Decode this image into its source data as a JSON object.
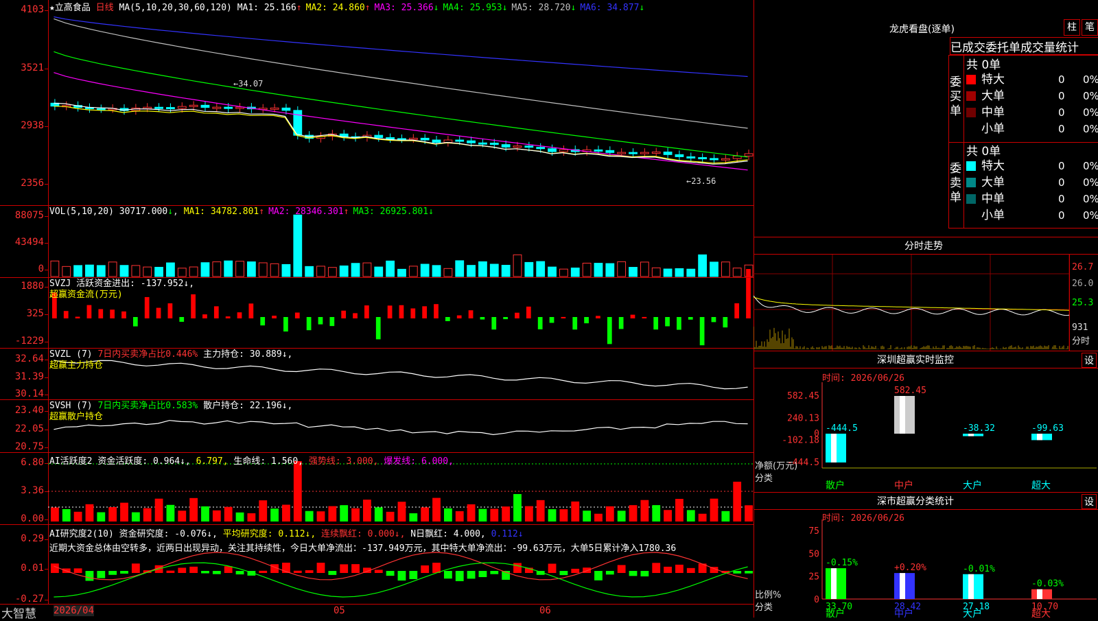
{
  "stock": {
    "name": "★立高食品",
    "period": "日线",
    "ma_label": "MA(5,10,20,30,60,120)",
    "ma": [
      {
        "label": "MA1: 25.166",
        "arrow": "↑",
        "color": "#ffffff"
      },
      {
        "label": "MA2: 24.860",
        "arrow": "↑",
        "color": "#ffff00"
      },
      {
        "label": "MA3: 25.366",
        "arrow": "↓",
        "color": "#ff00ff"
      },
      {
        "label": "MA4: 25.953",
        "arrow": "↓",
        "color": "#00ff00"
      },
      {
        "label": "MA5: 28.720",
        "arrow": "↓",
        "color": "#c0c0c0"
      },
      {
        "label": "MA6: 34.877",
        "arrow": "↓",
        "color": "#3333ff"
      }
    ],
    "y_labels": [
      "4103",
      "3521",
      "2938",
      "2356"
    ],
    "annot_high": "←34.07",
    "annot_low": "←23.56"
  },
  "vol": {
    "label": "VOL(5,10,20)",
    "value": "30717.000",
    "value_arrow": "↓",
    "ma": [
      {
        "label": "MA1: 34782.801",
        "arrow": "↑",
        "color": "#ffff00"
      },
      {
        "label": "MA2: 28346.301",
        "arrow": "↑",
        "color": "#ff00ff"
      },
      {
        "label": "MA3: 26925.801",
        "arrow": "↓",
        "color": "#00ff00"
      }
    ],
    "y_labels": [
      "88075",
      "43494",
      "0"
    ]
  },
  "svzj": {
    "label": "SVZJ",
    "title": "活跃资金进出: -137.952↓,",
    "sub": "超赢资金流(万元)",
    "y_labels": [
      "1880",
      "325",
      "-1229"
    ]
  },
  "svzl": {
    "label": "SVZL (7)",
    "pct": "7日内买卖净占比0.446%",
    "hold": "主力持仓: 30.889↓,",
    "sub": "超赢主力持仓",
    "y_labels": [
      "32.64",
      "31.39",
      "30.14"
    ]
  },
  "svsh": {
    "label": "SVSH (7)",
    "pct": "7日内买卖净占比0.583%",
    "hold": "散户持仓: 22.196↓,",
    "sub": "超赢散户持仓",
    "y_labels": [
      "23.40",
      "22.05",
      "20.75"
    ]
  },
  "ai1": {
    "label": "AI活跃度2",
    "v1": "资金活跃度: 0.964↓,",
    "v2": "6.797,",
    "v3": "生命线: 1.560,",
    "v4": "强势线: 3.000,",
    "v5": "爆发线: 6.000,",
    "y_labels": [
      "6.80",
      "3.36",
      "0.00"
    ]
  },
  "ai2": {
    "label": "AI研究度2(10)",
    "v1": "资金研究度: -0.076↓,",
    "v2": "平均研究度: 0.112↓,",
    "v3": "连续飘红: 0.000↓,",
    "v4": "N日飘红: 4.000,",
    "v5": "0.112↓",
    "comment": "近期大资金总体由空转多，近两日出现异动，关注其持续性，今日大单净流出：-137.949万元，其中特大单净流出：-99.63万元，大单5日累计净入1780.36",
    "y_labels": [
      "0.29",
      "0.01",
      "-0.27"
    ]
  },
  "xaxis": {
    "d1": "2026/04",
    "d2": "05",
    "d3": "06"
  },
  "brand": "大智慧",
  "right": {
    "top_title": "龙虎看盘(逐单)",
    "btn1": "柱",
    "btn2": "笔",
    "tabs": "已成交委托单成交量统计",
    "buy_label": "委买单",
    "sell_label": "委卖单",
    "buy_total": "共 0单",
    "sell_total": "共 0单",
    "buy_rows": [
      {
        "name": "特大",
        "count": "0",
        "pct": "0%",
        "color": "#ff0000"
      },
      {
        "name": "大单",
        "count": "0",
        "pct": "0%",
        "color": "#a00000"
      },
      {
        "name": "中单",
        "count": "0",
        "pct": "0%",
        "color": "#700000"
      },
      {
        "name": "小单",
        "count": "0",
        "pct": "0%",
        "color": "#000000"
      }
    ],
    "sell_rows": [
      {
        "name": "特大",
        "count": "0",
        "pct": "0%",
        "color": "#00ffff"
      },
      {
        "name": "大单",
        "count": "0",
        "pct": "0%",
        "color": "#008888"
      },
      {
        "name": "中单",
        "count": "0",
        "pct": "0%",
        "color": "#006666"
      },
      {
        "name": "小单",
        "count": "0",
        "pct": "0%",
        "color": "#000000"
      }
    ],
    "intraday_title": "分时走势",
    "intraday_labels": [
      "26.7",
      "26.0",
      "25.3",
      "931",
      "分时"
    ],
    "monitor_title": "深圳超赢实时监控",
    "monitor_time": "时间: 2026/06/26",
    "monitor_set": "设",
    "monitor_y": [
      "582.45",
      "240.13",
      "0",
      "-102.18",
      "-444.5"
    ],
    "monitor_axis_title": "净额(万元)",
    "monitor_axis_cat": "分类",
    "monitor_bars": [
      {
        "cat": "散户",
        "value": -444.5,
        "label": "-444.5"
      },
      {
        "cat": "中户",
        "value": 582.45,
        "label": "582.45"
      },
      {
        "cat": "大户",
        "value": -38.32,
        "label": "-38.32"
      },
      {
        "cat": "超大",
        "value": -99.63,
        "label": "-99.63"
      }
    ],
    "stat_title": "深市超赢分类统计",
    "stat_time": "时间: 2026/06/26",
    "stat_set": "设",
    "stat_y": [
      "75",
      "50",
      "25",
      "0"
    ],
    "stat_axis_title": "比例%",
    "stat_axis_cat": "分类",
    "stat_bars": [
      {
        "cat": "散户",
        "value": 33.7,
        "label": "33.70",
        "chg": "-0.15%",
        "color": "#00ff00"
      },
      {
        "cat": "中户",
        "value": 28.42,
        "label": "28.42",
        "chg": "+0.20%",
        "color": "#3333ff"
      },
      {
        "cat": "大户",
        "value": 27.18,
        "label": "27.18",
        "chg": "-0.01%",
        "color": "#00ffff"
      },
      {
        "cat": "超大",
        "value": 10.7,
        "label": "10.70",
        "chg": "-0.03%",
        "color": "#ff3333"
      }
    ]
  }
}
